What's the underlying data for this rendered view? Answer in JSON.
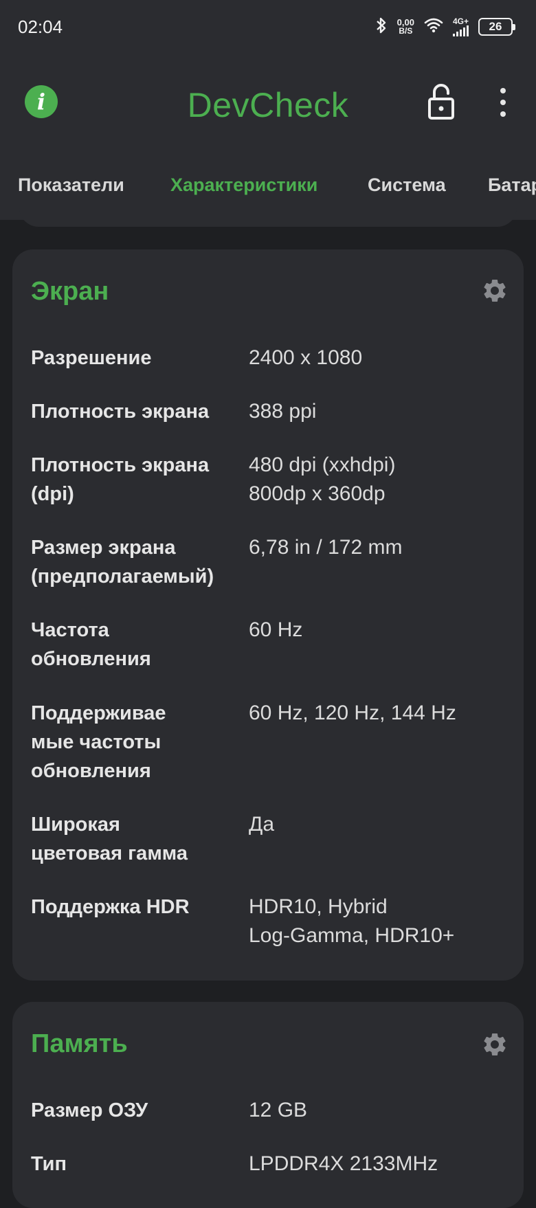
{
  "status_bar": {
    "time": "02:04",
    "net_speed_value": "0,00",
    "net_speed_unit": "B/S",
    "network_type": "4G+",
    "battery_level": "26"
  },
  "app": {
    "title": "DevCheck",
    "accent": "#4caf50",
    "icons": [
      "info-icon",
      "lock-open-icon",
      "more-vert-icon"
    ]
  },
  "tabs": [
    {
      "label": "Показатели"
    },
    {
      "label": "Характеристики",
      "active": true
    },
    {
      "label": "Система"
    },
    {
      "label": "Батар"
    }
  ],
  "screen_card": {
    "title": "Экран",
    "rows": [
      {
        "label": "Разрешение",
        "value": "2400 x 1080"
      },
      {
        "label": "Плотность экрана",
        "value": "388 ppi"
      },
      {
        "label": "Плотность экрана\n(dpi)",
        "value": "480 dpi (xxhdpi)\n800dp x 360dp"
      },
      {
        "label": "Размер экрана\n(предполагаемый)",
        "value": "6,78 in / 172 mm"
      },
      {
        "label": "Частота\nобновления",
        "value": "60 Hz"
      },
      {
        "label": "Поддерживае\nмые частоты\nобновления",
        "value": "60 Hz, 120 Hz, 144 Hz"
      },
      {
        "label": "Широкая\nцветовая гамма",
        "value": "Да"
      },
      {
        "label": "Поддержка HDR",
        "value": "HDR10, Hybrid\nLog-Gamma, HDR10+"
      }
    ]
  },
  "memory_card": {
    "title": "Память",
    "rows": [
      {
        "label": "Размер ОЗУ",
        "value": "12 GB"
      },
      {
        "label": "Тип",
        "value": "LPDDR4X 2133MHz"
      }
    ]
  }
}
